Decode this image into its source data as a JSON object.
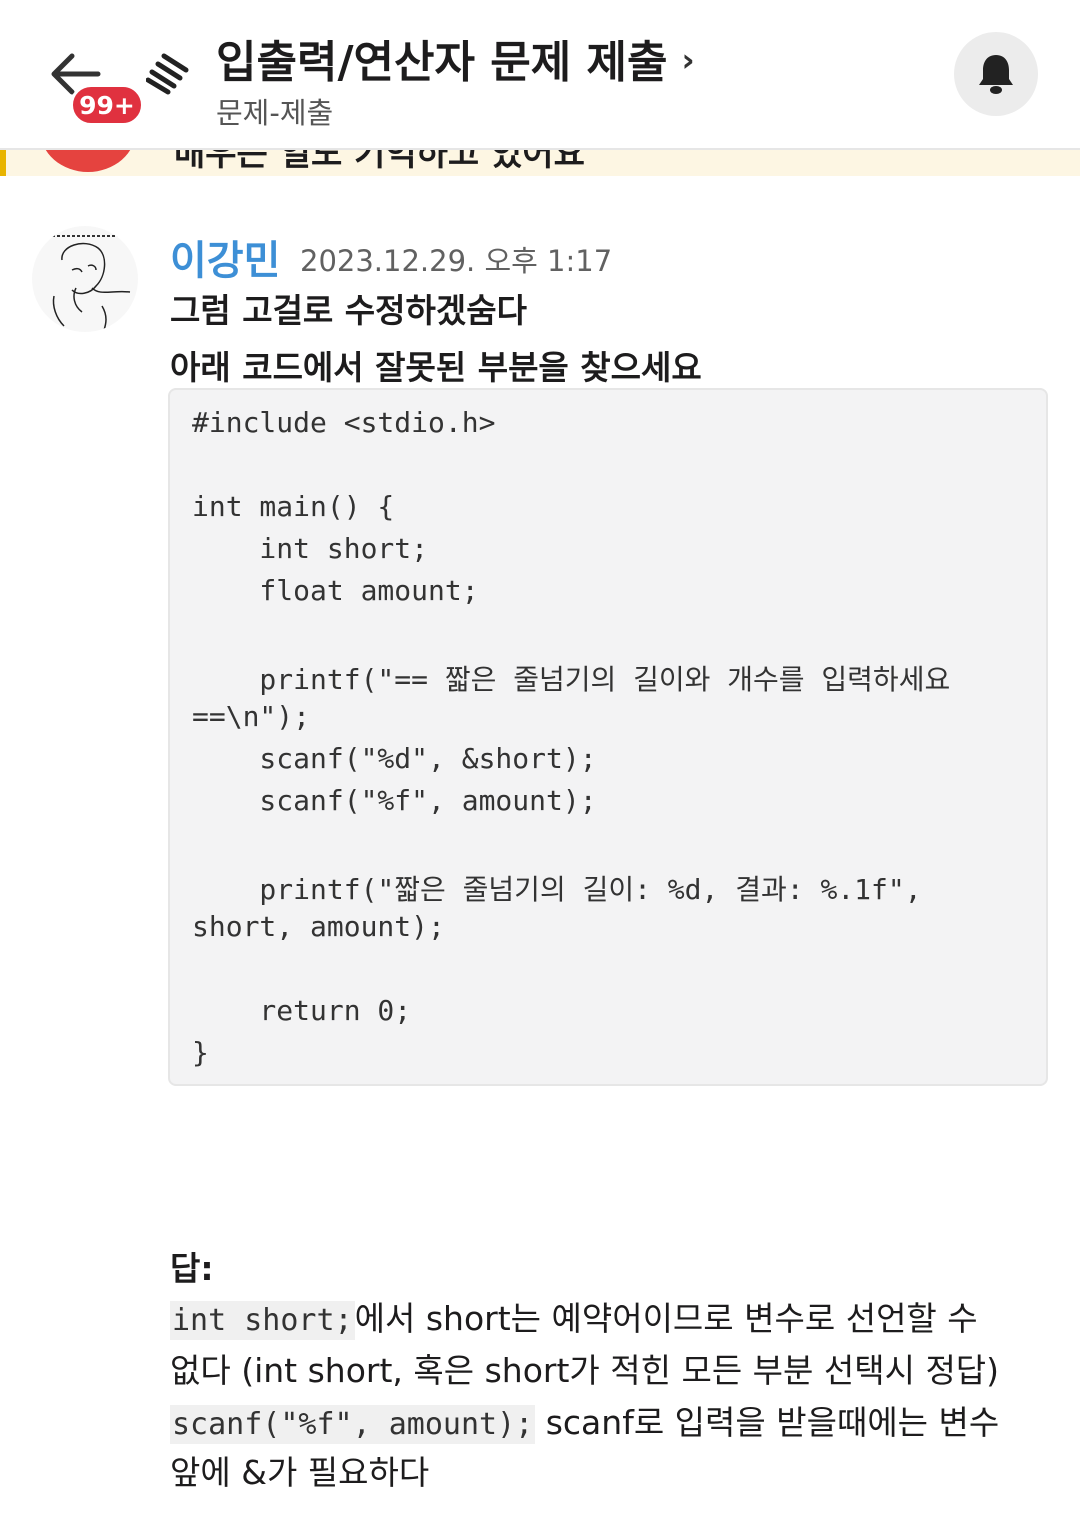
{
  "header": {
    "notification_badge": "99+",
    "title": "입출력/연산자 문제 제출",
    "title_chevron": "›",
    "subtitle": "문제-제출"
  },
  "banner": {
    "text": "배우는 일도 기억하고 있어요"
  },
  "message": {
    "author": "이강민",
    "timestamp": "2023.12.29. 오후 1:17",
    "lines": [
      "그럼 고걸로 수정하겠숨다",
      "아래 코드에서 잘못된 부분을 찾으세요"
    ],
    "code_lines": [
      "#include <stdio.h>",
      "int main() {",
      "    int short;",
      "    float amount;",
      "    printf(\"== 짧은 줄넘기의 길이와 개수를 입력하세요",
      "==\\n\");",
      "    scanf(\"%d\", &short);",
      "    scanf(\"%f\", amount);",
      "    printf(\"짧은 줄넘기의 길이: %d, 결과: %.1f\",",
      "short, amount);",
      "    return 0;",
      "}"
    ],
    "answer": {
      "label": "답:",
      "line1_code": "int short;",
      "line1_text": "에서 short는 예약어이므로 변수로 선언할 수",
      "line2_text": "없다 (int short, 혹은 short가 적힌 모든 부분 선택시 정답)",
      "line3_code": "scanf(\"%f\", amount);",
      "line3_text": " scanf로 입력을 받을때에는 변수",
      "line4_text": "앞에 &가 필요하다"
    }
  },
  "colors": {
    "author": "#3d8fd6",
    "badge": "#e0313f",
    "banner_bg": "#fdf6e3",
    "banner_accent": "#e8b400"
  }
}
